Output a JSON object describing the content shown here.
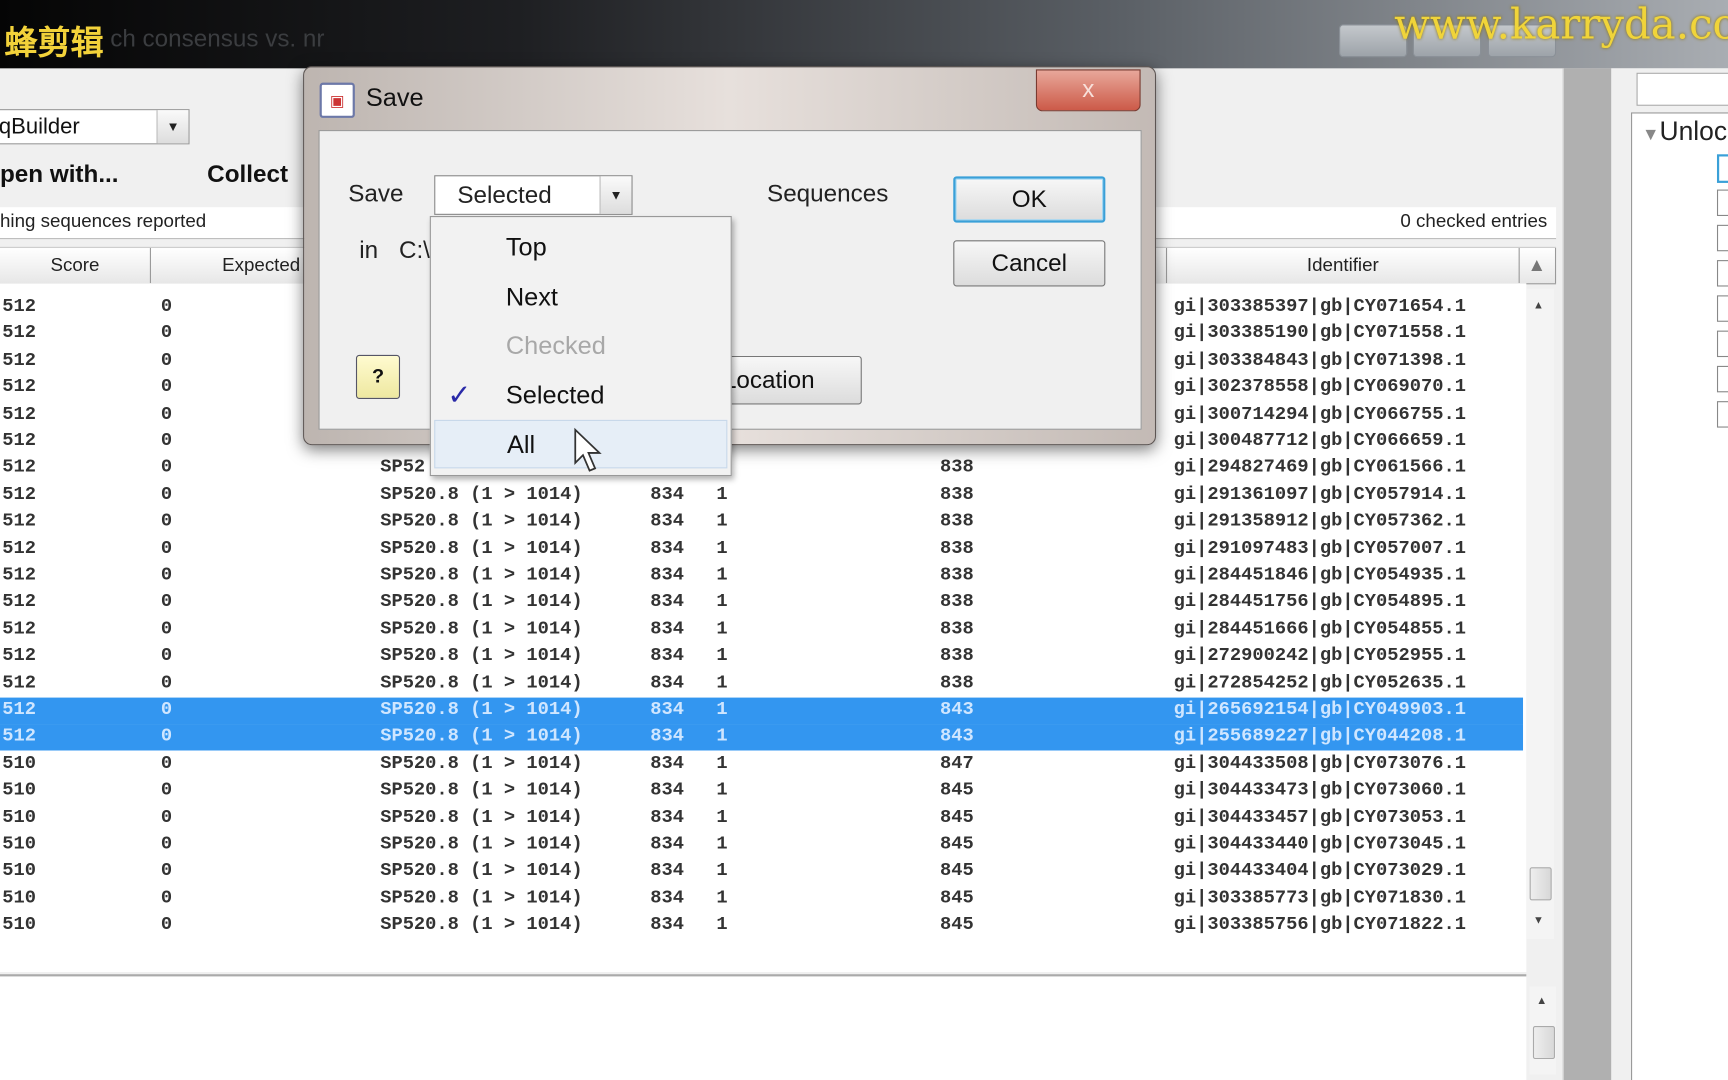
{
  "watermarks": {
    "left": "蜂剪辑",
    "right": "www.karryda.com"
  },
  "window": {
    "title": "ch consensus vs. nr"
  },
  "toolbar": {
    "combo_value": "qBuilder",
    "open_with": "pen with...",
    "collect": "Collect"
  },
  "status": {
    "left": "hing sequences reported",
    "right": "0 checked entries"
  },
  "table": {
    "headers": {
      "score": "Score",
      "expected": "Expected",
      "identifier": "Identifier"
    },
    "rows": [
      {
        "score": "512",
        "expected": "0",
        "hit": "",
        "len": "",
        "n": "",
        "col5": "",
        "id": "gi|303385397|gb|CY071654.1"
      },
      {
        "score": "512",
        "expected": "0",
        "hit": "",
        "len": "",
        "n": "",
        "col5": "",
        "id": "gi|303385190|gb|CY071558.1"
      },
      {
        "score": "512",
        "expected": "0",
        "hit": "",
        "len": "",
        "n": "",
        "col5": "",
        "id": "gi|303384843|gb|CY071398.1"
      },
      {
        "score": "512",
        "expected": "0",
        "hit": "",
        "len": "",
        "n": "",
        "col5": "",
        "id": "gi|302378558|gb|CY069070.1"
      },
      {
        "score": "512",
        "expected": "0",
        "hit": "",
        "len": "",
        "n": "",
        "col5": "",
        "id": "gi|300714294|gb|CY066755.1"
      },
      {
        "score": "512",
        "expected": "0",
        "hit": "",
        "len": "",
        "n": "",
        "col5": "",
        "id": "gi|300487712|gb|CY066659.1"
      },
      {
        "score": "512",
        "expected": "0",
        "hit": "SP52",
        "len": "",
        "n": "",
        "col5": "838",
        "id": "gi|294827469|gb|CY061566.1"
      },
      {
        "score": "512",
        "expected": "0",
        "hit": "SP520.8 (1 > 1014)",
        "len": "834",
        "n": "1",
        "col5": "838",
        "id": "gi|291361097|gb|CY057914.1"
      },
      {
        "score": "512",
        "expected": "0",
        "hit": "SP520.8 (1 > 1014)",
        "len": "834",
        "n": "1",
        "col5": "838",
        "id": "gi|291358912|gb|CY057362.1"
      },
      {
        "score": "512",
        "expected": "0",
        "hit": "SP520.8 (1 > 1014)",
        "len": "834",
        "n": "1",
        "col5": "838",
        "id": "gi|291097483|gb|CY057007.1"
      },
      {
        "score": "512",
        "expected": "0",
        "hit": "SP520.8 (1 > 1014)",
        "len": "834",
        "n": "1",
        "col5": "838",
        "id": "gi|284451846|gb|CY054935.1"
      },
      {
        "score": "512",
        "expected": "0",
        "hit": "SP520.8 (1 > 1014)",
        "len": "834",
        "n": "1",
        "col5": "838",
        "id": "gi|284451756|gb|CY054895.1"
      },
      {
        "score": "512",
        "expected": "0",
        "hit": "SP520.8 (1 > 1014)",
        "len": "834",
        "n": "1",
        "col5": "838",
        "id": "gi|284451666|gb|CY054855.1"
      },
      {
        "score": "512",
        "expected": "0",
        "hit": "SP520.8 (1 > 1014)",
        "len": "834",
        "n": "1",
        "col5": "838",
        "id": "gi|272900242|gb|CY052955.1"
      },
      {
        "score": "512",
        "expected": "0",
        "hit": "SP520.8 (1 > 1014)",
        "len": "834",
        "n": "1",
        "col5": "838",
        "id": "gi|272854252|gb|CY052635.1"
      },
      {
        "score": "512",
        "expected": "0",
        "hit": "SP520.8 (1 > 1014)",
        "len": "834",
        "n": "1",
        "col5": "843",
        "id": "gi|265692154|gb|CY049903.1",
        "selected": true
      },
      {
        "score": "512",
        "expected": "0",
        "hit": "SP520.8 (1 > 1014)",
        "len": "834",
        "n": "1",
        "col5": "843",
        "id": "gi|255689227|gb|CY044208.1",
        "selected": true
      },
      {
        "score": "510",
        "expected": "0",
        "hit": "SP520.8 (1 > 1014)",
        "len": "834",
        "n": "1",
        "col5": "847",
        "id": "gi|304433508|gb|CY073076.1"
      },
      {
        "score": "510",
        "expected": "0",
        "hit": "SP520.8 (1 > 1014)",
        "len": "834",
        "n": "1",
        "col5": "845",
        "id": "gi|304433473|gb|CY073060.1"
      },
      {
        "score": "510",
        "expected": "0",
        "hit": "SP520.8 (1 > 1014)",
        "len": "834",
        "n": "1",
        "col5": "845",
        "id": "gi|304433457|gb|CY073053.1"
      },
      {
        "score": "510",
        "expected": "0",
        "hit": "SP520.8 (1 > 1014)",
        "len": "834",
        "n": "1",
        "col5": "845",
        "id": "gi|304433440|gb|CY073045.1"
      },
      {
        "score": "510",
        "expected": "0",
        "hit": "SP520.8 (1 > 1014)",
        "len": "834",
        "n": "1",
        "col5": "845",
        "id": "gi|304433404|gb|CY073029.1"
      },
      {
        "score": "510",
        "expected": "0",
        "hit": "SP520.8 (1 > 1014)",
        "len": "834",
        "n": "1",
        "col5": "845",
        "id": "gi|303385773|gb|CY071830.1"
      },
      {
        "score": "510",
        "expected": "0",
        "hit": "SP520.8 (1 > 1014)",
        "len": "834",
        "n": "1",
        "col5": "845",
        "id": "gi|303385756|gb|CY071822.1"
      }
    ]
  },
  "right_panel": {
    "tree_label": "Unloc"
  },
  "dialog": {
    "title": "Save",
    "close": "x",
    "save_label": "Save",
    "save_value": "Selected",
    "sequences_label": "Sequences",
    "in_label": "in",
    "path": "C:\\",
    "ok": "OK",
    "cancel": "Cancel",
    "location": "Location",
    "help": "?",
    "dropdown": [
      {
        "label": "Top"
      },
      {
        "label": "Next"
      },
      {
        "label": "Checked",
        "disabled": true
      },
      {
        "label": "Selected",
        "checked": true
      },
      {
        "label": "All",
        "hover": true
      }
    ]
  },
  "colors": {
    "selection": "#3396f0",
    "ok_border": "#3aa0d8",
    "close": "#cc5a48",
    "watermark": "#f0d43a"
  }
}
